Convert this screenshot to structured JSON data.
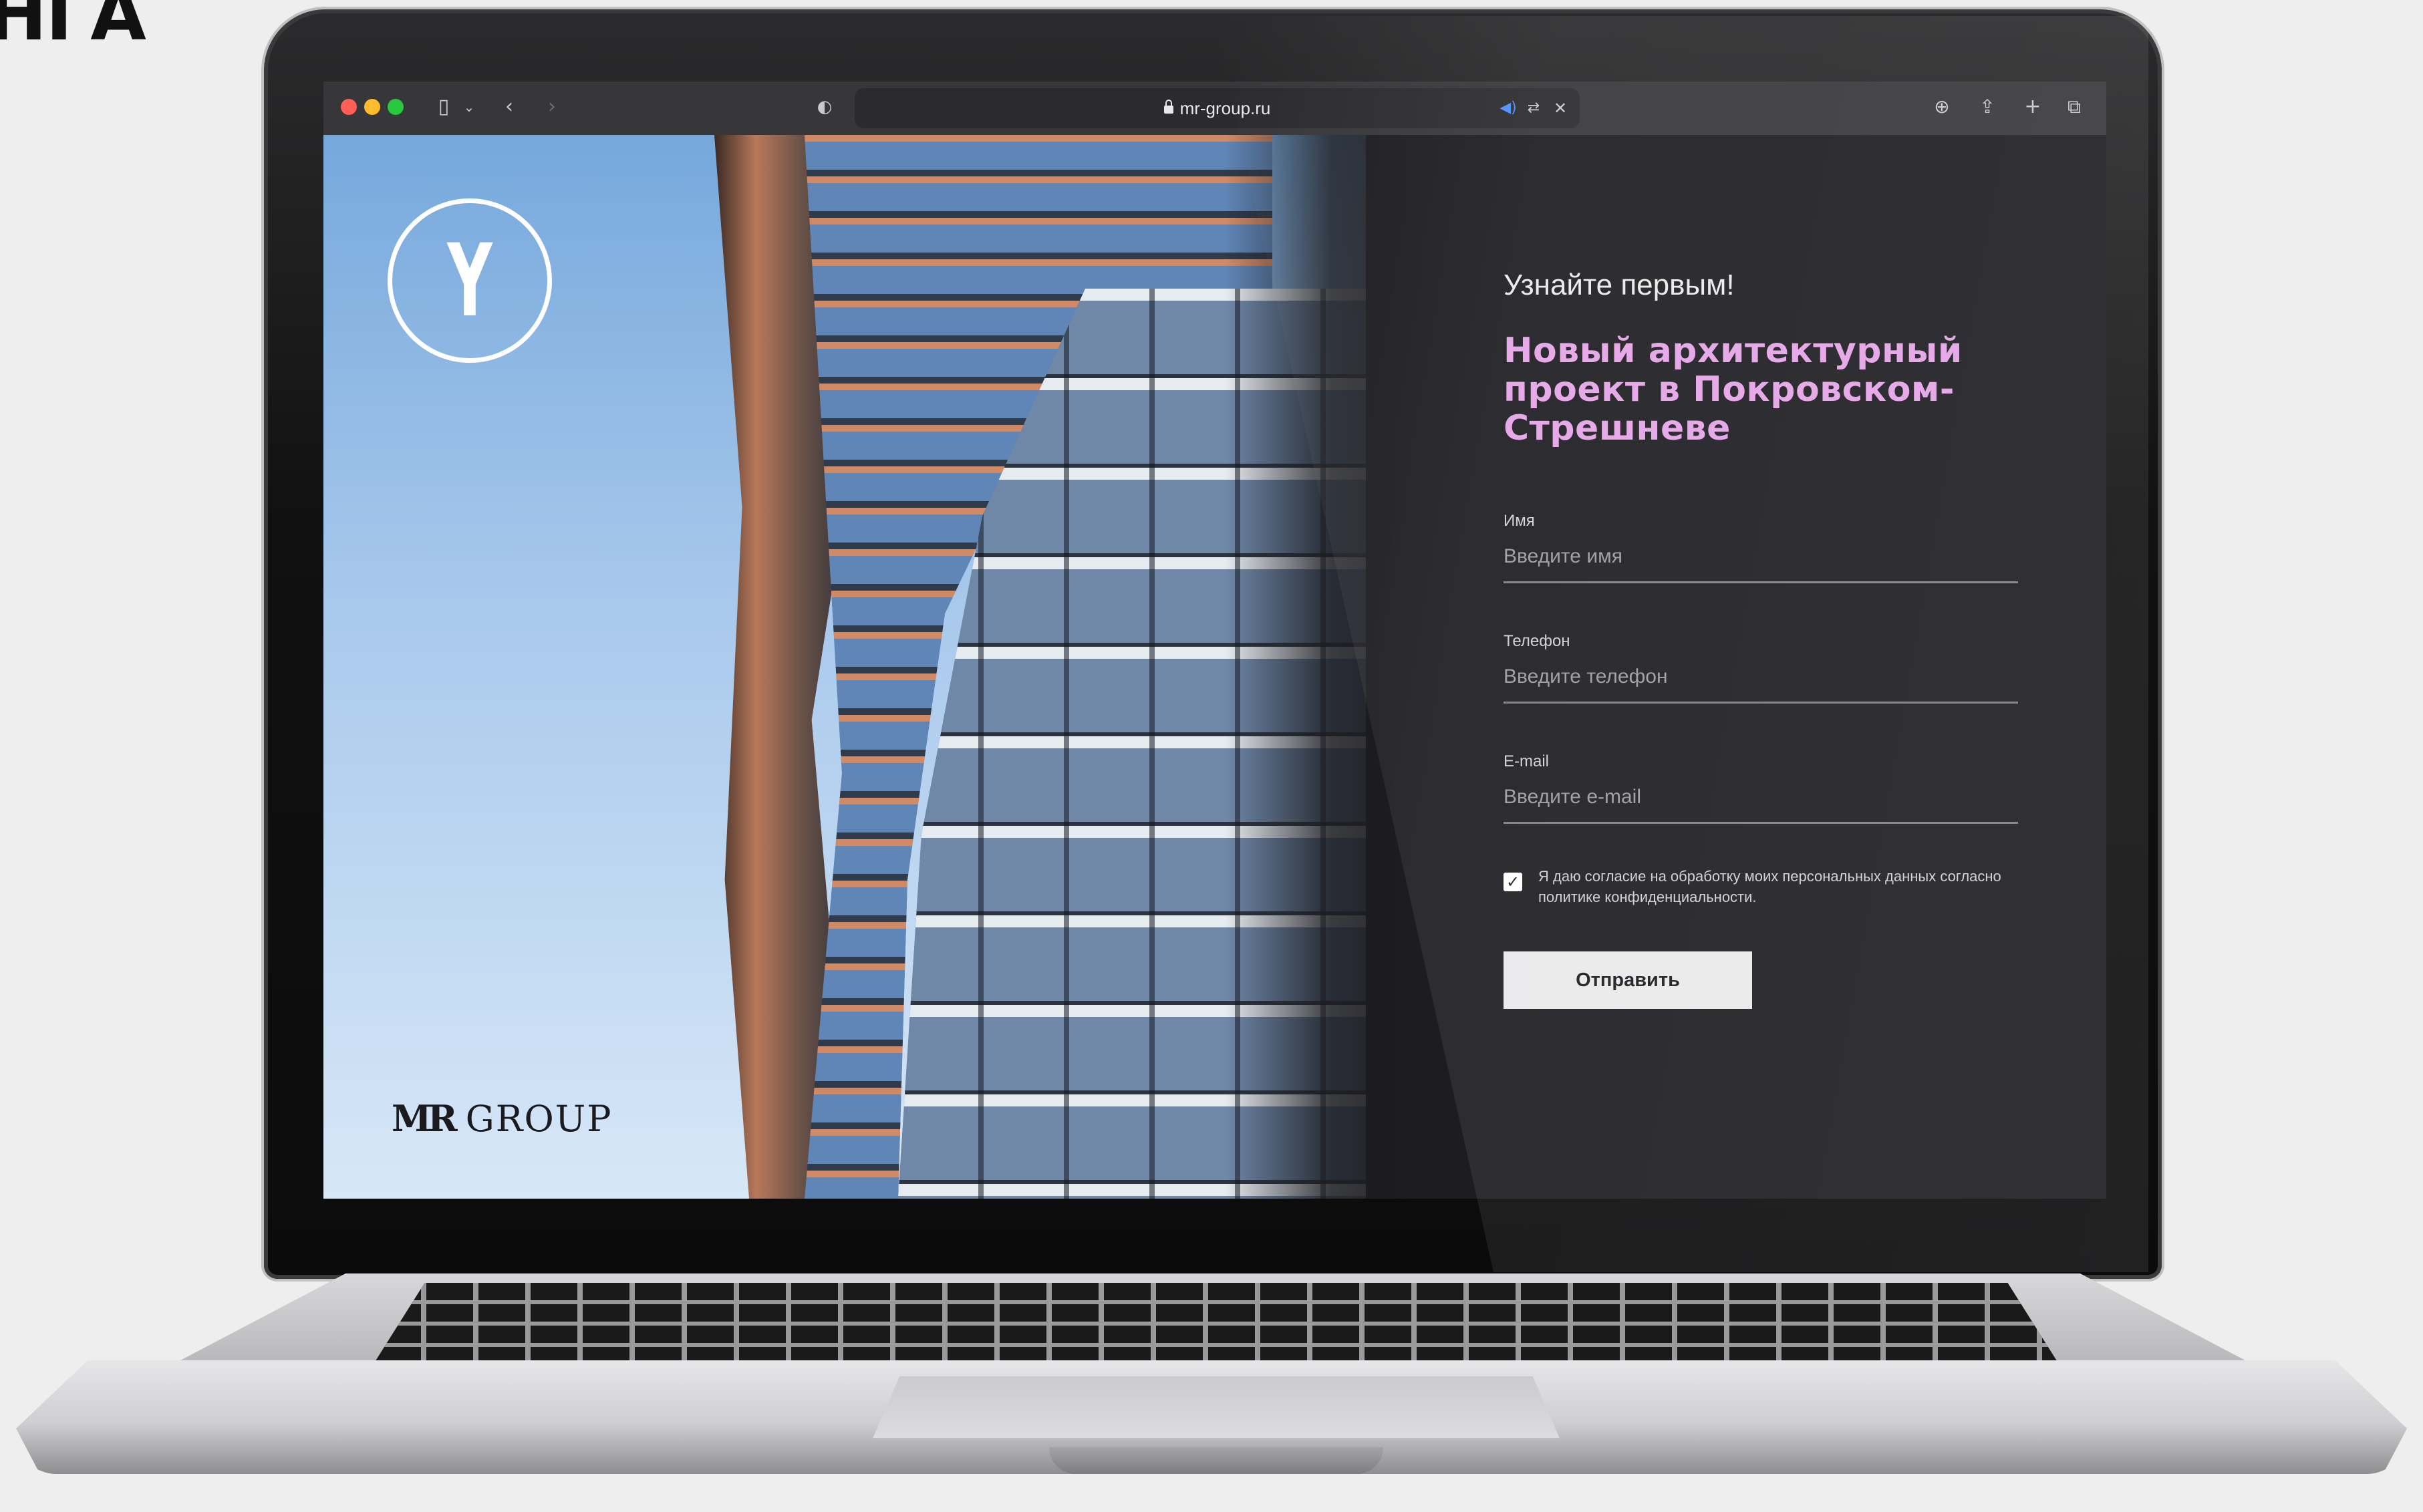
{
  "corner_text": "НГА",
  "browser": {
    "url": "mr-group.ru",
    "icons": [
      "sidebar-icon",
      "chevron-down-icon",
      "back-icon",
      "forward-icon",
      "shield-icon",
      "audio-icon",
      "translate-icon",
      "close-icon",
      "download-icon",
      "share-icon",
      "new-tab-icon",
      "tabs-overview-icon"
    ]
  },
  "hero": {
    "logo_letter": "Y",
    "brand_mr": "MR",
    "brand_group": "GROUP"
  },
  "form": {
    "pre_title": "Узнайте первым!",
    "headline": "Новый архитектурный проект в Покровском-Стрешневе",
    "fields": [
      {
        "label": "Имя",
        "placeholder": "Введите имя"
      },
      {
        "label": "Телефон",
        "placeholder": "Введите телефон"
      },
      {
        "label": "E-mail",
        "placeholder": "Введите e-mail"
      }
    ],
    "consent_checked": true,
    "consent_text": "Я даю согласие на обработку моих персональных данных согласно политике конфиденциальности.",
    "submit_label": "Отправить"
  },
  "colors": {
    "headline": "#e4a3e6",
    "panel": "#1d1d21",
    "button": "#e9e9eb"
  }
}
